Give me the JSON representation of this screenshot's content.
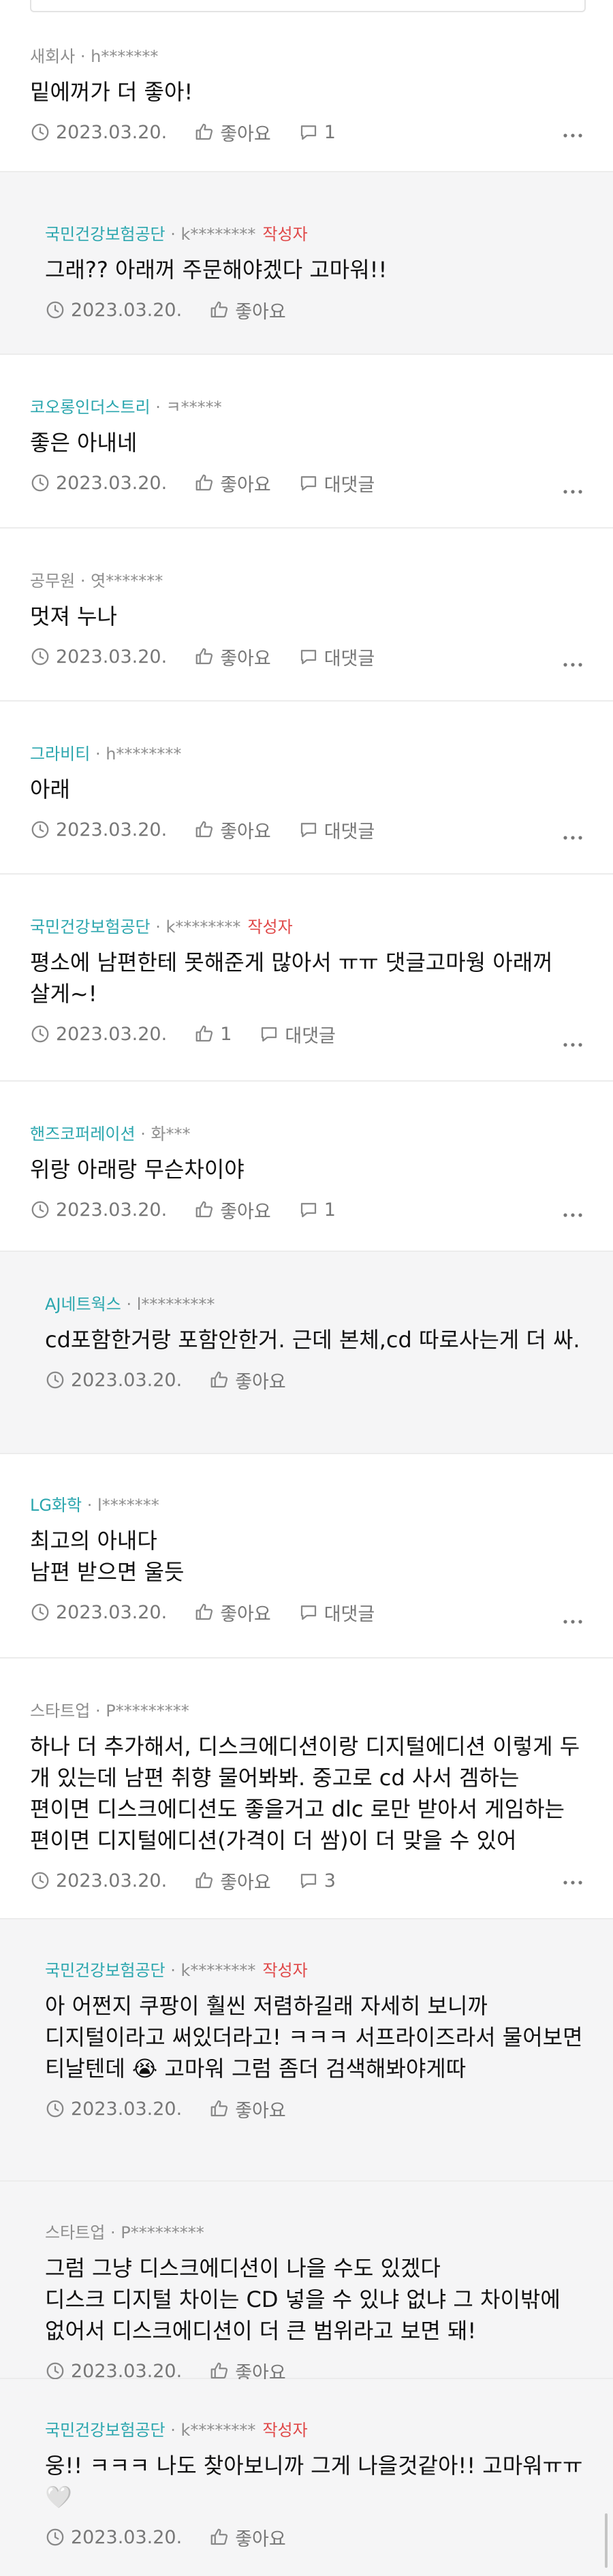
{
  "comments": [
    {
      "company": "새회사",
      "user": "h*******",
      "text": "밑에꺼가 더 좋아!",
      "date": "2023.03.20.",
      "like": "좋아요",
      "reply": "1"
    },
    {
      "company": "국민건강보험공단",
      "user": "k********",
      "badge": "작성자",
      "text": "그래?? 아래꺼 주문해야겠다 고마워!!",
      "date": "2023.03.20.",
      "like": "좋아요"
    },
    {
      "company": "코오롱인더스트리",
      "user": "ㅋ*****",
      "text": "좋은 아내네",
      "date": "2023.03.20.",
      "like": "좋아요",
      "reply": "대댓글"
    },
    {
      "company": "공무원",
      "user": "엿*******",
      "text": "멋져 누나",
      "date": "2023.03.20.",
      "like": "좋아요",
      "reply": "대댓글"
    },
    {
      "company": "그라비티",
      "user": "h********",
      "text": "아래",
      "date": "2023.03.20.",
      "like": "좋아요",
      "reply": "대댓글"
    },
    {
      "company": "국민건강보험공단",
      "user": "k********",
      "badge": "작성자",
      "text": "평소에 남편한테 못해준게 많아서 ㅠㅠ 댓글고마웡 아래꺼 살게~!",
      "date": "2023.03.20.",
      "like": "1",
      "reply": "대댓글"
    },
    {
      "company": "핸즈코퍼레이션",
      "user": "화***",
      "text": "위랑 아래랑 무슨차이야",
      "date": "2023.03.20.",
      "like": "좋아요",
      "reply": "1"
    },
    {
      "company": "AJ네트웍스",
      "user": "l*********",
      "text": "cd포함한거랑 포함안한거. 근데 본체,cd 따로사는게 더 싸.",
      "date": "2023.03.20.",
      "like": "좋아요"
    },
    {
      "company": "LG화학",
      "user": "l*******",
      "text": "최고의 아내다\n남편 받으면 울듯",
      "date": "2023.03.20.",
      "like": "좋아요",
      "reply": "대댓글"
    },
    {
      "company": "스타트업",
      "user": "P*********",
      "text": "하나 더 추가해서, 디스크에디션이랑 디지털에디션 이렇게 두 개 있는데 남편 취향 물어봐봐. 중고로 cd 사서 겜하는 편이면 디스크에디션도 좋을거고 dlc 로만 받아서 게임하는 편이면 디지털에디션(가격이 더 쌈)이 더 맞을 수 있어",
      "date": "2023.03.20.",
      "like": "좋아요",
      "reply": "3"
    },
    {
      "company": "국민건강보험공단",
      "user": "k********",
      "badge": "작성자",
      "text": "아 어쩐지 쿠팡이 훨씬 저렴하길래 자세히 보니까 디지털이라고 써있더라고! ㅋㅋㅋ 서프라이즈라서 물어보면 티날텐데 😭 고마워 그럼 좀더 검색해봐야게따",
      "date": "2023.03.20.",
      "like": "좋아요"
    },
    {
      "company": "스타트업",
      "user": "P*********",
      "text": "그럼 그냥 디스크에디션이 나을 수도 있겠다\n디스크 디지털 차이는 CD 넣을 수 있냐 없냐 그 차이밖에 없어서 디스크에디션이 더 큰 범위라고 보면 돼!",
      "date": "2023.03.20.",
      "like": "좋아요"
    },
    {
      "company": "국민건강보험공단",
      "user": "k********",
      "badge": "작성자",
      "text": "웅!! ㅋㅋㅋ 나도 찾아보니까 그게 나을것같아!! 고마워ㅠㅠ🤍",
      "date": "2023.03.20.",
      "like": "좋아요"
    }
  ],
  "colors": {
    "company_accent": "#2aa6ae",
    "author_badge": "#e04848",
    "reply_background": "#f5f5f6"
  },
  "icons": {
    "time": "clock-icon",
    "like": "thumbs-up-icon",
    "reply": "speech-bubble-icon",
    "more": "more-dots-icon"
  }
}
